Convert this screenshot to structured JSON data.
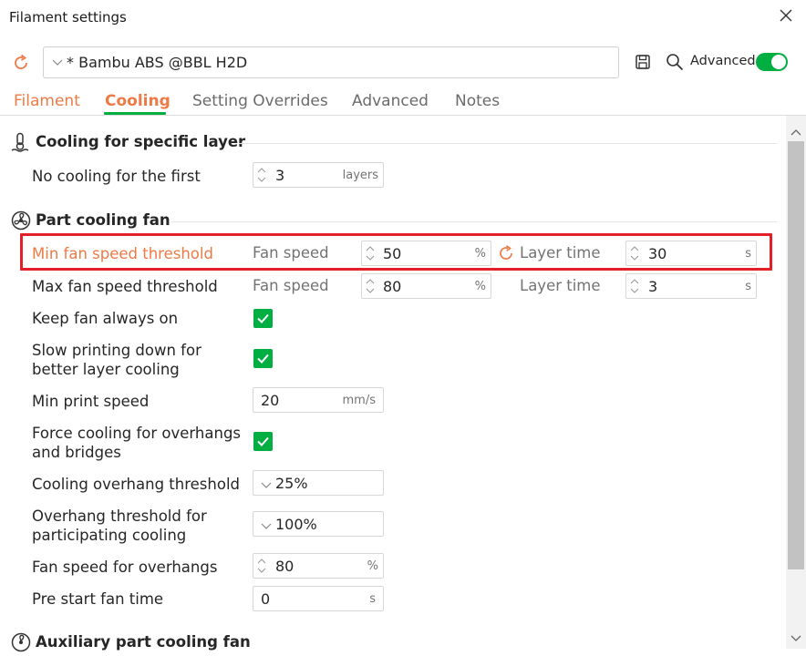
{
  "window": {
    "title": "Filament settings"
  },
  "preset": {
    "name": "* Bambu ABS @BBL H2D",
    "advanced_label": "Advanced"
  },
  "tabs": [
    "Filament",
    "Cooling",
    "Setting Overrides",
    "Advanced",
    "Notes"
  ],
  "colors": {
    "accent_green": "#00ae42",
    "accent_orange": "#ee7a45",
    "highlight_red": "#e3202a"
  },
  "sections": {
    "specific_layer": {
      "title": "Cooling for specific layer",
      "no_cooling": {
        "label": "No cooling for the first",
        "value": "3",
        "unit": "layers"
      }
    },
    "part_fan": {
      "title": "Part cooling fan",
      "min_fan": {
        "label": "Min fan speed threshold",
        "speed_label": "Fan speed",
        "speed_value": "50",
        "speed_unit": "%",
        "time_label": "Layer time",
        "time_value": "30",
        "time_unit": "s"
      },
      "max_fan": {
        "label": "Max fan speed threshold",
        "speed_label": "Fan speed",
        "speed_value": "80",
        "speed_unit": "%",
        "time_label": "Layer time",
        "time_value": "3",
        "time_unit": "s"
      },
      "keep_fan": {
        "label": "Keep fan always on",
        "checked": true
      },
      "slow_down": {
        "label_1": "Slow printing down for",
        "label_2": "better layer cooling",
        "checked": true
      },
      "min_print_speed": {
        "label": "Min print speed",
        "value": "20",
        "unit": "mm/s"
      },
      "force_cooling": {
        "label_1": "Force cooling for overhangs",
        "label_2": "and bridges",
        "checked": true
      },
      "overhang_threshold": {
        "label": "Cooling overhang threshold",
        "value": "25%"
      },
      "participating": {
        "label_1": "Overhang threshold for",
        "label_2": "participating cooling",
        "value": "100%"
      },
      "fan_overhangs": {
        "label": "Fan speed for overhangs",
        "value": "80",
        "unit": "%"
      },
      "pre_start": {
        "label": "Pre start fan time",
        "value": "0",
        "unit": "s"
      }
    },
    "aux_fan": {
      "title": "Auxiliary part cooling fan"
    }
  },
  "icons": {
    "reset": "reset-arrow-icon",
    "save": "save-icon",
    "search": "search-icon",
    "close": "close-icon",
    "thermometer": "thermometer-icon",
    "fan": "fan-icon",
    "check": "checkmark-icon",
    "chevron": "chevron-down-icon",
    "spin": "spin-arrows-icon"
  }
}
